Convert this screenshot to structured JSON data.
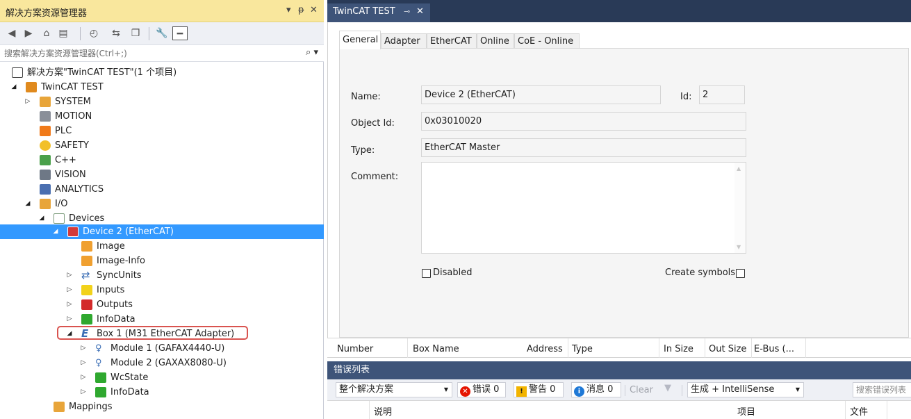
{
  "solution_explorer": {
    "title": "解决方案资源管理器",
    "title_controls": {
      "dropdown": "▾",
      "pin": "ᵽ",
      "close": "✕"
    },
    "search_placeholder": "搜索解决方案资源管理器(Ctrl+;)",
    "tree": [
      {
        "label": "解决方案\"TwinCAT TEST\"(1 个项目)",
        "icon": "solution-icon",
        "color": "#5a5a5a"
      },
      {
        "label": "TwinCAT TEST",
        "icon": "project-icon",
        "color": "#e08a1e"
      },
      {
        "label": "SYSTEM",
        "icon": "system-icon",
        "color": "#e8a53a"
      },
      {
        "label": "MOTION",
        "icon": "motion-icon",
        "color": "#8a8f99"
      },
      {
        "label": "PLC",
        "icon": "plc-icon",
        "color": "#f07a1a"
      },
      {
        "label": "SAFETY",
        "icon": "safety-icon",
        "color": "#f2c02a"
      },
      {
        "label": "C++",
        "icon": "cpp-icon",
        "color": "#4aa04a"
      },
      {
        "label": "VISION",
        "icon": "vision-icon",
        "color": "#6e7886"
      },
      {
        "label": "ANALYTICS",
        "icon": "analytics-icon",
        "color": "#4a6fb0"
      },
      {
        "label": "I/O",
        "icon": "io-icon",
        "color": "#e8a53a"
      },
      {
        "label": "Devices",
        "icon": "devices-icon",
        "color": "#7a9a7a"
      },
      {
        "label": "Device 2 (EtherCAT)",
        "icon": "ethercat-device-icon",
        "color": "#d33a3a"
      },
      {
        "label": "Image",
        "icon": "image-icon",
        "color": "#f0a030"
      },
      {
        "label": "Image-Info",
        "icon": "image-info-icon",
        "color": "#f0a030"
      },
      {
        "label": "SyncUnits",
        "icon": "syncunits-icon",
        "color": "#3a6db5"
      },
      {
        "label": "Inputs",
        "icon": "inputs-icon",
        "color": "#f2d21a"
      },
      {
        "label": "Outputs",
        "icon": "outputs-icon",
        "color": "#d32a2a"
      },
      {
        "label": "InfoData",
        "icon": "infodata-icon",
        "color": "#2fa82f"
      },
      {
        "label": "Box 1 (M31 EtherCAT Adapter)",
        "icon": "box-e-icon",
        "color": "#3a6db5"
      },
      {
        "label": "Module 1 (GAFAX4440-U)",
        "icon": "module-icon",
        "color": "#3a6db5"
      },
      {
        "label": "Module 2 (GAXAX8080-U)",
        "icon": "module-icon",
        "color": "#3a6db5"
      },
      {
        "label": "WcState",
        "icon": "wcstate-icon",
        "color": "#2fa82f"
      },
      {
        "label": "InfoData",
        "icon": "infodata-icon",
        "color": "#2fa82f"
      },
      {
        "label": "Mappings",
        "icon": "mappings-icon",
        "color": "#e8a53a"
      }
    ]
  },
  "document_tab": {
    "title": "TwinCAT TEST",
    "pin": "⊸",
    "close": "✕"
  },
  "property_tabs": [
    "General",
    "Adapter",
    "EtherCAT",
    "Online",
    "CoE - Online"
  ],
  "general": {
    "name_label": "Name:",
    "name_value": "Device 2 (EtherCAT)",
    "id_label": "Id:",
    "id_value": "2",
    "object_id_label": "Object Id:",
    "object_id_value": "0x03010020",
    "type_label": "Type:",
    "type_value": "EtherCAT Master",
    "comment_label": "Comment:",
    "disabled_label": "Disabled",
    "create_symbols_label": "Create symbols"
  },
  "box_columns": [
    "Number",
    "Box Name",
    "Address",
    "Type",
    "In Size",
    "Out Size",
    "E-Bus (..."
  ],
  "error_list": {
    "title": "错误列表",
    "scope": "整个解决方案",
    "errors_label": "错误 0",
    "warnings_label": "警告 0",
    "messages_label": "消息 0",
    "clear_label": "Clear",
    "build_filter": "生成 + IntelliSense",
    "search_placeholder": "搜索错误列表",
    "columns": [
      "说明",
      "项目",
      "文件"
    ]
  },
  "colors": {
    "title_yellow": "#f9e79d",
    "selection_blue": "#3399ff",
    "dark_navy": "#293a57",
    "tab_blue": "#3e5479",
    "highlight_red": "#d9534f"
  }
}
